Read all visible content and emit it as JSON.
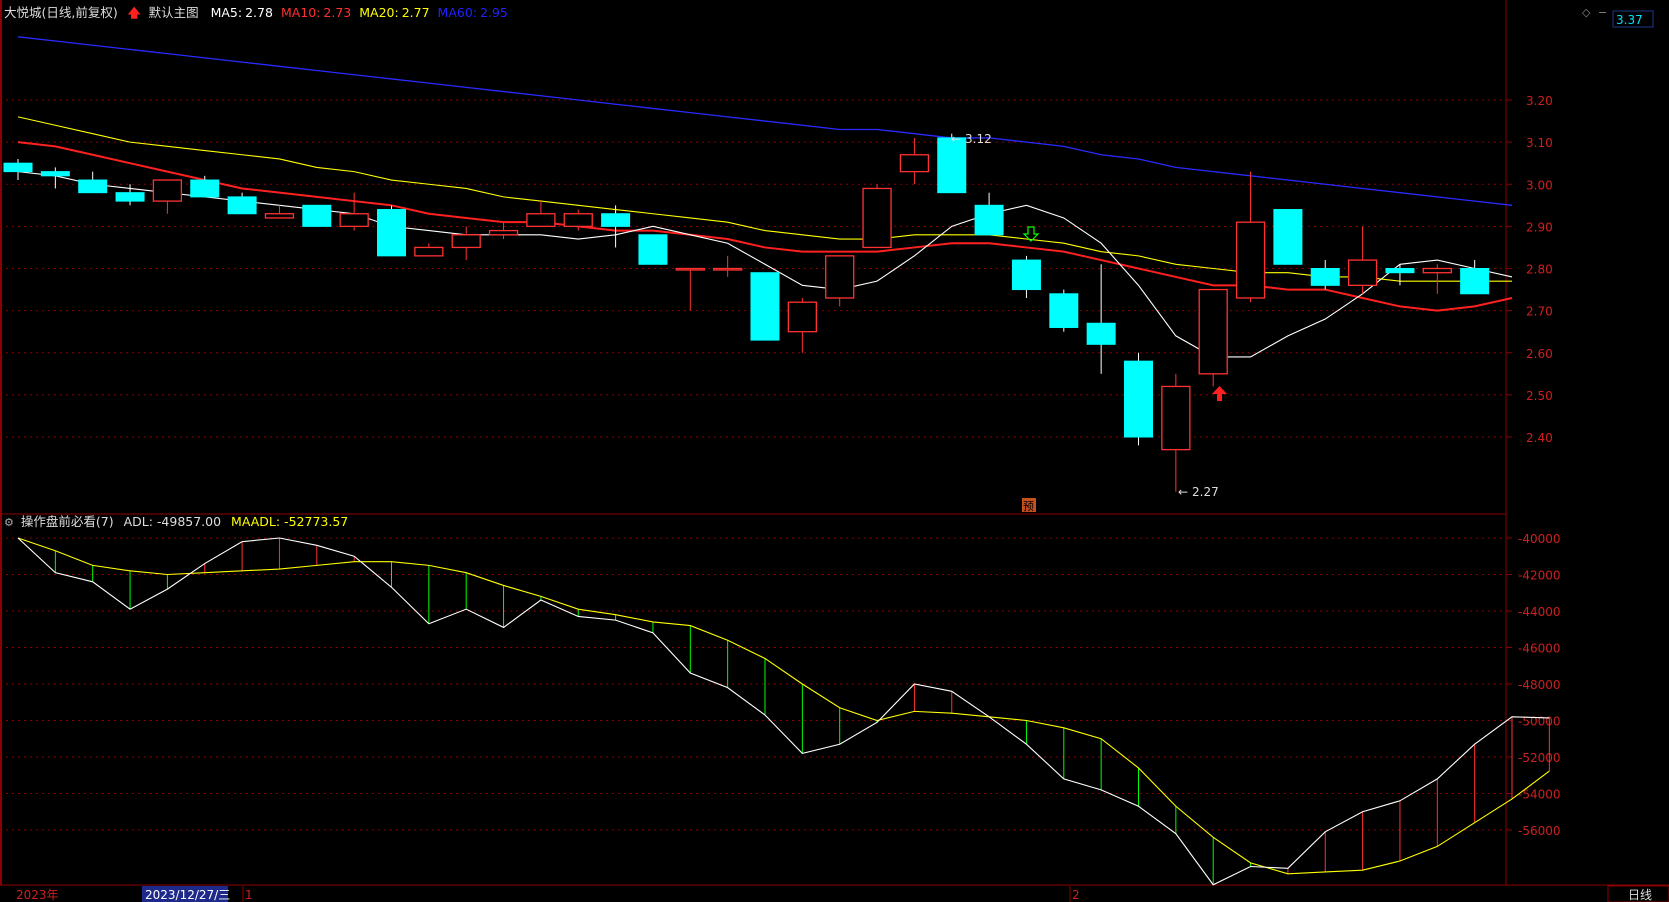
{
  "header": {
    "stock_name": "大悦城",
    "period_label": "(日线,前复权)",
    "main_template": "默认主图",
    "ma": [
      {
        "label": "MA5:",
        "value": "2.78",
        "color": "#ffffff"
      },
      {
        "label": "MA10:",
        "value": "2.73",
        "color": "#ff3030"
      },
      {
        "label": "MA20:",
        "value": "2.77",
        "color": "#ffff00"
      },
      {
        "label": "MA60:",
        "value": "2.95",
        "color": "#2020ff"
      }
    ],
    "top_right_price": "3.37"
  },
  "indicator_header": {
    "name": "操作盘前必看(7)",
    "adl_label": "ADL:",
    "adl_value": "-49857.00",
    "maadl_label": "MAADL:",
    "maadl_value": "-52773.57"
  },
  "annotations": {
    "high_label": "3.12",
    "low_label": "2.27",
    "forecast_badge": "预"
  },
  "bottom_bar": {
    "year_label": "2023年",
    "date_cursor": "2023/12/27/三",
    "month_1": "1",
    "month_2": "2",
    "period_button": "日线"
  },
  "colors": {
    "up": "#ff3232",
    "down": "#00ffff",
    "grid": "#8b0000",
    "ma5": "#ffffff",
    "ma10": "#ff2020",
    "ma20": "#ffff00",
    "ma60": "#2a2aff",
    "adl": "#ffffff",
    "maadl": "#ffff00"
  },
  "chart_data": [
    {
      "type": "candlestick",
      "y_ticks": [
        "3.20",
        "3.10",
        "3.00",
        "2.90",
        "2.80",
        "2.70",
        "2.60",
        "2.50",
        "2.40"
      ],
      "ylim": [
        2.25,
        3.37
      ],
      "candles": [
        {
          "o": 3.05,
          "h": 3.06,
          "l": 3.01,
          "c": 3.03
        },
        {
          "o": 3.03,
          "h": 3.04,
          "l": 2.99,
          "c": 3.02
        },
        {
          "o": 3.01,
          "h": 3.03,
          "l": 2.98,
          "c": 2.98
        },
        {
          "o": 2.98,
          "h": 3.0,
          "l": 2.95,
          "c": 2.96
        },
        {
          "o": 2.96,
          "h": 3.01,
          "l": 2.93,
          "c": 3.01
        },
        {
          "o": 3.01,
          "h": 3.02,
          "l": 2.97,
          "c": 2.97
        },
        {
          "o": 2.97,
          "h": 2.98,
          "l": 2.93,
          "c": 2.93
        },
        {
          "o": 2.92,
          "h": 2.95,
          "l": 2.92,
          "c": 2.93
        },
        {
          "o": 2.95,
          "h": 2.95,
          "l": 2.9,
          "c": 2.9
        },
        {
          "o": 2.9,
          "h": 2.98,
          "l": 2.89,
          "c": 2.93
        },
        {
          "o": 2.94,
          "h": 2.95,
          "l": 2.83,
          "c": 2.83
        },
        {
          "o": 2.83,
          "h": 2.86,
          "l": 2.83,
          "c": 2.85
        },
        {
          "o": 2.85,
          "h": 2.9,
          "l": 2.82,
          "c": 2.88
        },
        {
          "o": 2.88,
          "h": 2.91,
          "l": 2.87,
          "c": 2.89
        },
        {
          "o": 2.9,
          "h": 2.96,
          "l": 2.9,
          "c": 2.93
        },
        {
          "o": 2.9,
          "h": 2.94,
          "l": 2.89,
          "c": 2.93
        },
        {
          "o": 2.93,
          "h": 2.95,
          "l": 2.85,
          "c": 2.9
        },
        {
          "o": 2.88,
          "h": 2.88,
          "l": 2.81,
          "c": 2.81
        },
        {
          "o": 2.8,
          "h": 2.8,
          "l": 2.7,
          "c": 2.8
        },
        {
          "o": 2.8,
          "h": 2.83,
          "l": 2.78,
          "c": 2.8
        },
        {
          "o": 2.79,
          "h": 2.79,
          "l": 2.63,
          "c": 2.63
        },
        {
          "o": 2.65,
          "h": 2.73,
          "l": 2.6,
          "c": 2.72
        },
        {
          "o": 2.73,
          "h": 2.83,
          "l": 2.71,
          "c": 2.83
        },
        {
          "o": 2.85,
          "h": 3.0,
          "l": 2.85,
          "c": 2.99
        },
        {
          "o": 3.03,
          "h": 3.11,
          "l": 3.0,
          "c": 3.07
        },
        {
          "o": 3.11,
          "h": 3.12,
          "l": 2.98,
          "c": 2.98
        },
        {
          "o": 2.95,
          "h": 2.98,
          "l": 2.88,
          "c": 2.88
        },
        {
          "o": 2.82,
          "h": 2.83,
          "l": 2.73,
          "c": 2.75
        },
        {
          "o": 2.74,
          "h": 2.75,
          "l": 2.65,
          "c": 2.66
        },
        {
          "o": 2.67,
          "h": 2.81,
          "l": 2.55,
          "c": 2.62
        },
        {
          "o": 2.58,
          "h": 2.6,
          "l": 2.38,
          "c": 2.4
        },
        {
          "o": 2.37,
          "h": 2.55,
          "l": 2.27,
          "c": 2.52
        },
        {
          "o": 2.55,
          "h": 2.75,
          "l": 2.52,
          "c": 2.75
        },
        {
          "o": 2.73,
          "h": 3.03,
          "l": 2.72,
          "c": 2.91
        },
        {
          "o": 2.94,
          "h": 2.94,
          "l": 2.81,
          "c": 2.81
        },
        {
          "o": 2.8,
          "h": 2.82,
          "l": 2.75,
          "c": 2.76
        },
        {
          "o": 2.76,
          "h": 2.9,
          "l": 2.74,
          "c": 2.82
        },
        {
          "o": 2.8,
          "h": 2.81,
          "l": 2.76,
          "c": 2.79
        },
        {
          "o": 2.79,
          "h": 2.81,
          "l": 2.74,
          "c": 2.8
        },
        {
          "o": 2.8,
          "h": 2.82,
          "l": 2.74,
          "c": 2.74
        }
      ],
      "ma5": [
        3.03,
        3.02,
        3.0,
        2.99,
        2.98,
        2.97,
        2.96,
        2.95,
        2.94,
        2.93,
        2.9,
        2.89,
        2.88,
        2.88,
        2.88,
        2.87,
        2.88,
        2.9,
        2.88,
        2.86,
        2.81,
        2.76,
        2.75,
        2.77,
        2.83,
        2.9,
        2.93,
        2.95,
        2.92,
        2.86,
        2.76,
        2.64,
        2.59,
        2.59,
        2.64,
        2.68,
        2.74,
        2.81,
        2.82,
        2.8,
        2.78
      ],
      "ma10": [
        3.1,
        3.09,
        3.07,
        3.05,
        3.03,
        3.01,
        2.99,
        2.98,
        2.97,
        2.96,
        2.95,
        2.93,
        2.92,
        2.91,
        2.91,
        2.9,
        2.89,
        2.89,
        2.88,
        2.87,
        2.85,
        2.84,
        2.84,
        2.84,
        2.85,
        2.86,
        2.86,
        2.85,
        2.84,
        2.82,
        2.8,
        2.78,
        2.76,
        2.76,
        2.75,
        2.75,
        2.73,
        2.71,
        2.7,
        2.71,
        2.73
      ],
      "ma20": [
        3.16,
        3.14,
        3.12,
        3.1,
        3.09,
        3.08,
        3.07,
        3.06,
        3.04,
        3.03,
        3.01,
        3.0,
        2.99,
        2.97,
        2.96,
        2.95,
        2.94,
        2.93,
        2.92,
        2.91,
        2.89,
        2.88,
        2.87,
        2.87,
        2.88,
        2.88,
        2.88,
        2.87,
        2.86,
        2.84,
        2.83,
        2.81,
        2.8,
        2.79,
        2.79,
        2.78,
        2.78,
        2.77,
        2.77,
        2.77,
        2.77
      ],
      "ma60": [
        3.35,
        3.34,
        3.33,
        3.32,
        3.31,
        3.3,
        3.29,
        3.28,
        3.27,
        3.26,
        3.25,
        3.24,
        3.23,
        3.22,
        3.21,
        3.2,
        3.19,
        3.18,
        3.17,
        3.16,
        3.15,
        3.14,
        3.13,
        3.13,
        3.12,
        3.11,
        3.11,
        3.1,
        3.09,
        3.07,
        3.06,
        3.04,
        3.03,
        3.02,
        3.01,
        3.0,
        2.99,
        2.98,
        2.97,
        2.96,
        2.95
      ]
    },
    {
      "type": "line",
      "title": "操作盘前必看(7)",
      "y_ticks": [
        "-40000",
        "-42000",
        "-44000",
        "-46000",
        "-48000",
        "-50000",
        "-52000",
        "-54000",
        "-56000"
      ],
      "ylim": [
        -59500,
        -39200
      ],
      "series": [
        {
          "name": "ADL",
          "values": [
            -40000,
            -41900,
            -42400,
            -43900,
            -42800,
            -41400,
            -40200,
            -40000,
            -40400,
            -41000,
            -42700,
            -44700,
            -43900,
            -44900,
            -43400,
            -44300,
            -44500,
            -45200,
            -47400,
            -48200,
            -49700,
            -51800,
            -51300,
            -50100,
            -48000,
            -48400,
            -49800,
            -51300,
            -53200,
            -53800,
            -54700,
            -56200,
            -59000,
            -58000,
            -58100,
            -56100,
            -55000,
            -54400,
            -53200,
            -51300,
            -49800,
            -49857
          ]
        },
        {
          "name": "MAADL",
          "values": [
            -40000,
            -40700,
            -41500,
            -41800,
            -42000,
            -41900,
            -41800,
            -41700,
            -41500,
            -41300,
            -41300,
            -41500,
            -41900,
            -42600,
            -43200,
            -43900,
            -44200,
            -44600,
            -44800,
            -45600,
            -46600,
            -48000,
            -49300,
            -50000,
            -49500,
            -49600,
            -49800,
            -50000,
            -50400,
            -51000,
            -52600,
            -54700,
            -56400,
            -57800,
            -58400,
            -58300,
            -58200,
            -57700,
            -56900,
            -55600,
            -54300,
            -52773.57
          ]
        }
      ]
    }
  ]
}
